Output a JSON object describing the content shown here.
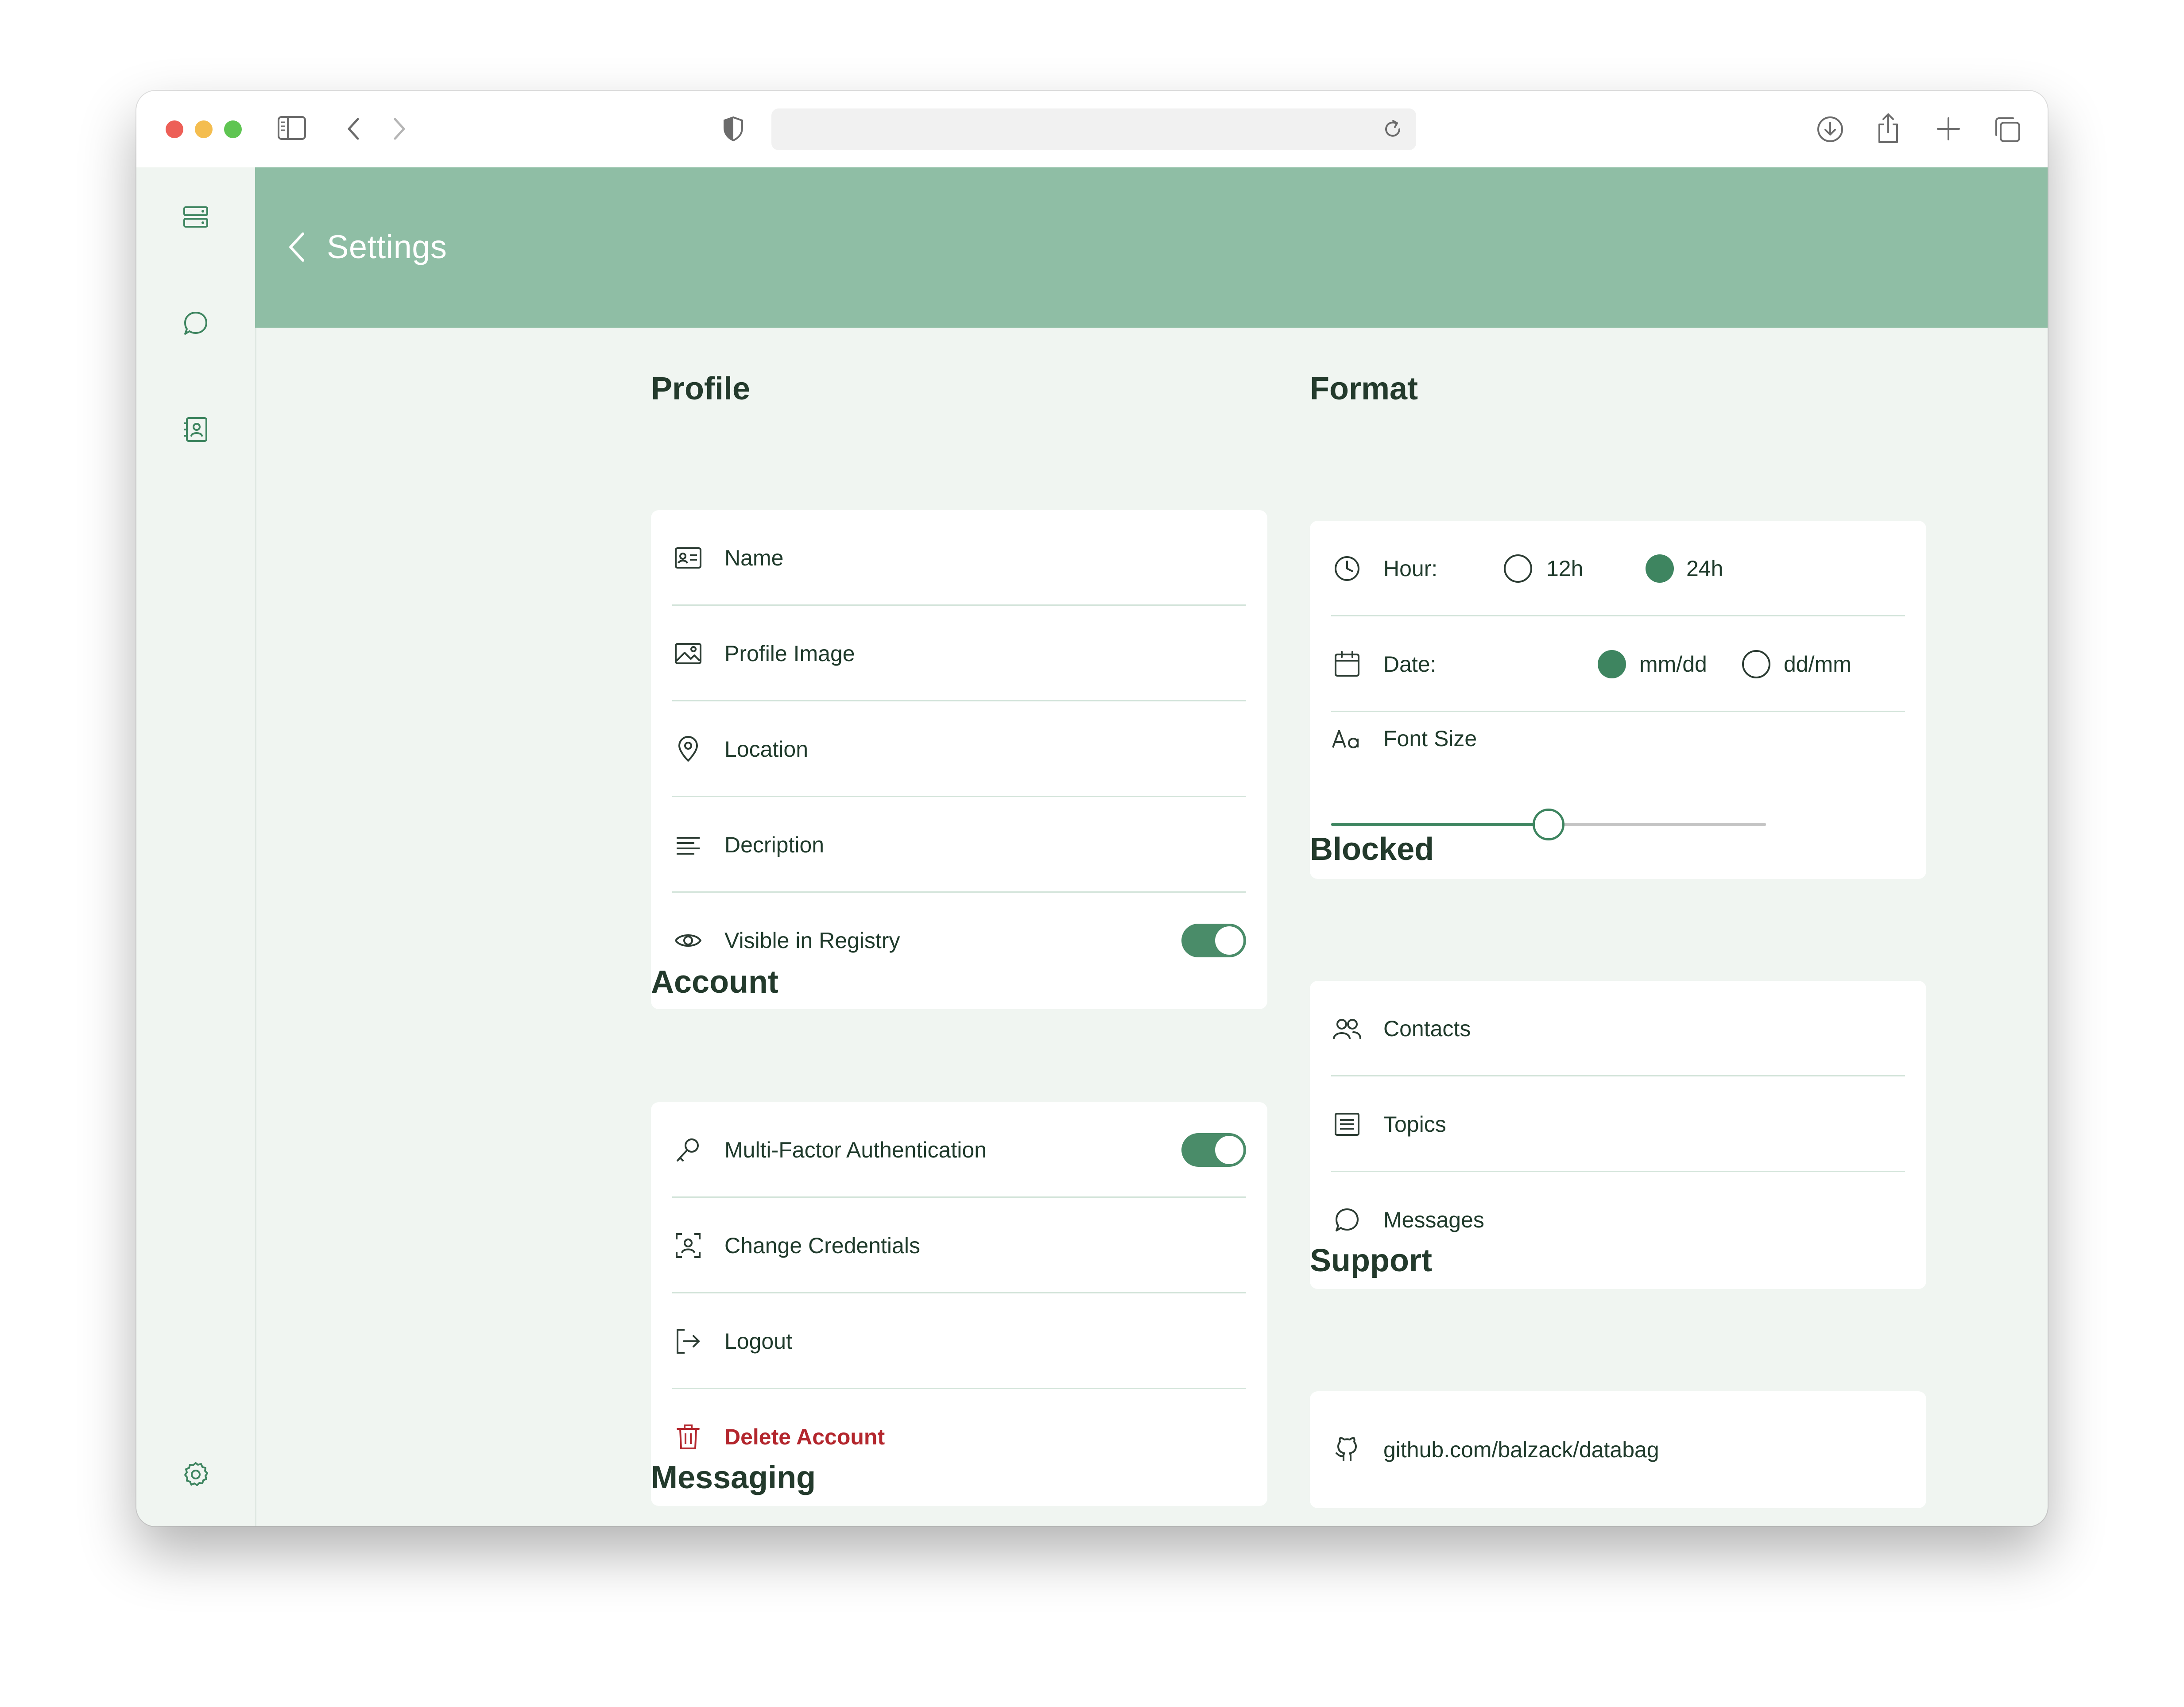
{
  "browser": {
    "address": ""
  },
  "header": {
    "title": "Settings"
  },
  "profile": {
    "title": "Profile",
    "items": [
      {
        "label": "Name",
        "icon": "id-card-icon"
      },
      {
        "label": "Profile Image",
        "icon": "image-icon"
      },
      {
        "label": "Location",
        "icon": "location-pin-icon"
      },
      {
        "label": "Decription",
        "icon": "lines-icon"
      },
      {
        "label": "Visible in Registry",
        "icon": "eye-icon",
        "toggle_on": true
      }
    ]
  },
  "account": {
    "title": "Account",
    "items": [
      {
        "label": "Multi-Factor Authentication",
        "icon": "key-icon",
        "toggle_on": true
      },
      {
        "label": "Change Credentials",
        "icon": "face-scan-icon"
      },
      {
        "label": "Logout",
        "icon": "logout-icon"
      },
      {
        "label": "Delete Account",
        "icon": "trash-icon",
        "color": "#b3262d"
      }
    ]
  },
  "messaging": {
    "title": "Messaging"
  },
  "format": {
    "title": "Format",
    "hour": {
      "label": "Hour:",
      "options": [
        "12h",
        "24h"
      ],
      "selected": "24h"
    },
    "date": {
      "label": "Date:",
      "options": [
        "mm/dd",
        "dd/mm"
      ],
      "selected": "mm/dd"
    },
    "font_size": {
      "label": "Font Size",
      "value": 0.5
    }
  },
  "blocked": {
    "title": "Blocked",
    "items": [
      {
        "label": "Contacts",
        "icon": "users-icon"
      },
      {
        "label": "Topics",
        "icon": "list-icon"
      },
      {
        "label": "Messages",
        "icon": "chat-bubble-icon"
      }
    ]
  },
  "support": {
    "title": "Support",
    "link": "github.com/balzack/databag"
  },
  "colors": {
    "header": "#8fbea5",
    "accent": "#3e8560",
    "background": "#f0f5f1",
    "danger": "#b3262d"
  }
}
